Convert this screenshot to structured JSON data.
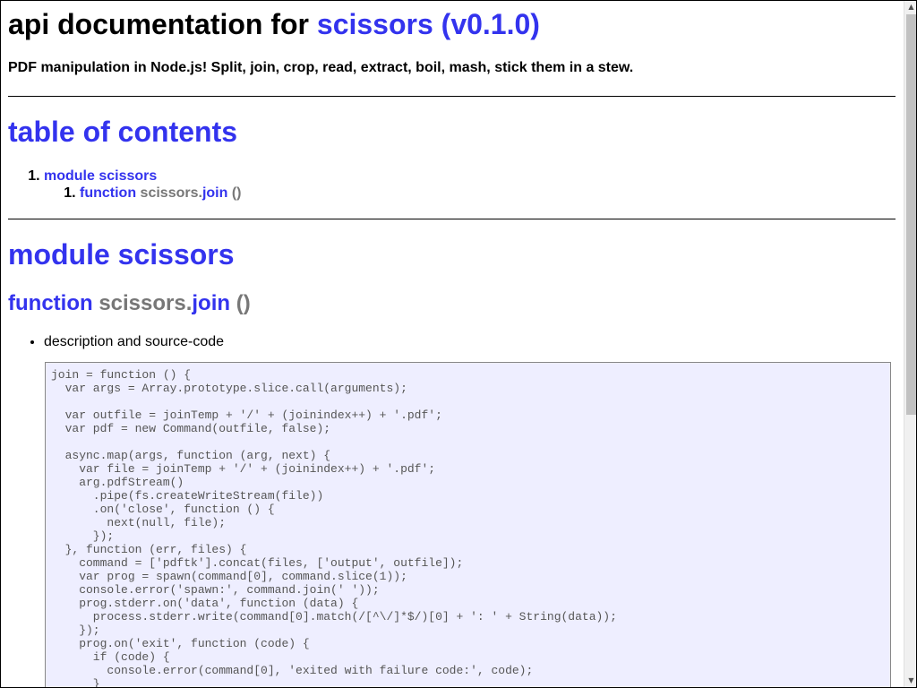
{
  "header": {
    "title_prefix": "api documentation for",
    "title_link": "scissors (v0.1.0)",
    "subtitle": "PDF manipulation in Node.js! Split, join, crop, read, extract, boil, mash, stick them in a stew."
  },
  "toc": {
    "heading": "table of contents",
    "module_label": "module scissors",
    "function_keyword": "function",
    "function_object": "scissors.",
    "function_name": "join",
    "function_parens": "()"
  },
  "module": {
    "heading": "module scissors",
    "function_keyword": "function",
    "function_object": "scissors.",
    "function_name": "join",
    "function_parens": "()",
    "description_label": "description and source-code",
    "source_code": "join = function () {\n  var args = Array.prototype.slice.call(arguments);\n\n  var outfile = joinTemp + '/' + (joinindex++) + '.pdf';\n  var pdf = new Command(outfile, false);\n\n  async.map(args, function (arg, next) {\n    var file = joinTemp + '/' + (joinindex++) + '.pdf';\n    arg.pdfStream()\n      .pipe(fs.createWriteStream(file))\n      .on('close', function () {\n        next(null, file);\n      });\n  }, function (err, files) {\n    command = ['pdftk'].concat(files, ['output', outfile]);\n    var prog = spawn(command[0], command.slice(1));\n    console.error('spawn:', command.join(' '));\n    prog.stderr.on('data', function (data) {\n      process.stderr.write(command[0].match(/[^\\/]*$/)[0] + ': ' + String(data));\n    });\n    prog.on('exit', function (code) {\n      if (code) {\n        console.error(command[0], 'exited with failure code:', code);\n      }"
  },
  "colors": {
    "link": "#3333ee",
    "muted": "#777777",
    "code_background": "#eeeeff"
  },
  "icons": {
    "scroll_up": "triangle-up-icon",
    "scroll_down": "triangle-down-icon"
  }
}
